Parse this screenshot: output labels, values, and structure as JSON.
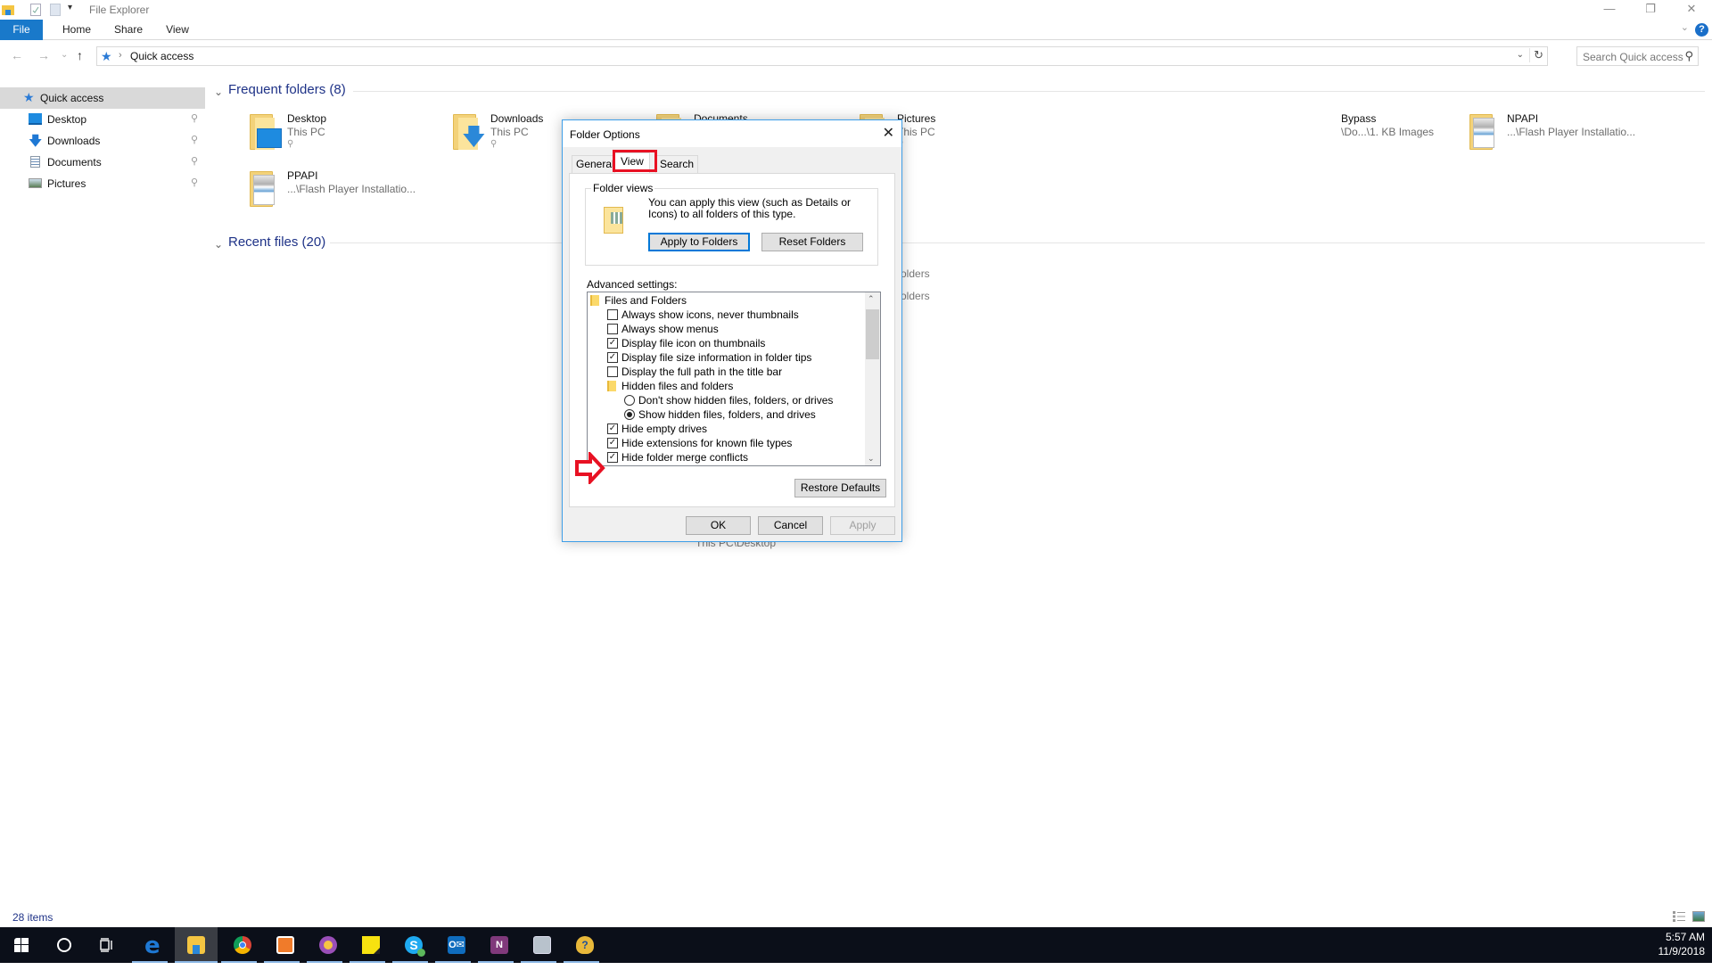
{
  "window": {
    "title": "File Explorer",
    "controls": {
      "minimize": "—",
      "restore": "❐",
      "close": "✕"
    }
  },
  "ribbon": {
    "tabs": [
      {
        "label": "File",
        "active": true
      },
      {
        "label": "Home"
      },
      {
        "label": "Share"
      },
      {
        "label": "View"
      }
    ],
    "help": "?",
    "expand": "⌄"
  },
  "address": {
    "back": "←",
    "forward": "→",
    "recent": "⌄",
    "up": "↑",
    "root_icon": "★",
    "separator": "›",
    "path": "Quick access",
    "dropdown": "⌄",
    "refresh": "↻"
  },
  "search": {
    "placeholder": "Search Quick access",
    "icon": "⚲"
  },
  "nav": {
    "items": [
      {
        "label": "Quick access",
        "icon": "quick-access",
        "selected": true,
        "pinned": false
      },
      {
        "label": "Desktop",
        "icon": "desktop",
        "pinned": true
      },
      {
        "label": "Downloads",
        "icon": "downloads",
        "pinned": true
      },
      {
        "label": "Documents",
        "icon": "documents",
        "pinned": true
      },
      {
        "label": "Pictures",
        "icon": "pictures",
        "pinned": true
      }
    ],
    "pin_glyph": "📌"
  },
  "main": {
    "frequent_header": "Frequent folders (8)",
    "recent_header": "Recent files (20)",
    "chevron": "⌄",
    "frequent": [
      {
        "name": "Desktop",
        "sub": "This PC",
        "pinned": true
      },
      {
        "name": "Downloads",
        "sub": "This PC",
        "pinned": true
      },
      {
        "name": "Documents",
        "sub": "",
        "pinned": false
      },
      {
        "name": "Pictures",
        "sub": "This PC",
        "pinned": true
      },
      {
        "name": "Bypass",
        "sub": "\\Do...\\1. KB Images",
        "pinned": false
      },
      {
        "name": "NPAPI",
        "sub": "...\\Flash Player Installatio...",
        "pinned": false
      },
      {
        "name": "PPAPI",
        "sub": "...\\Flash Player Installatio...",
        "pinned": false
      }
    ],
    "recent_partial": [
      "olders",
      "olders",
      "This PC\\Desktop"
    ]
  },
  "status": {
    "items": "28 items"
  },
  "dialog": {
    "title": "Folder Options",
    "close": "✕",
    "tabs": [
      {
        "label": "General"
      },
      {
        "label": "View",
        "selected": true,
        "highlighted": true
      },
      {
        "label": "Search"
      }
    ],
    "folder_views": {
      "legend": "Folder views",
      "description": "You can apply this view (such as Details or Icons) to all folders of this type.",
      "apply_btn": "Apply to Folders",
      "reset_btn": "Reset Folders"
    },
    "advanced_label": "Advanced settings:",
    "advanced": [
      {
        "type": "folder",
        "label": "Files and Folders",
        "indent": 0
      },
      {
        "type": "checkbox",
        "label": "Always show icons, never thumbnails",
        "checked": false,
        "indent": 1
      },
      {
        "type": "checkbox",
        "label": "Always show menus",
        "checked": false,
        "indent": 1
      },
      {
        "type": "checkbox",
        "label": "Display file icon on thumbnails",
        "checked": true,
        "indent": 1
      },
      {
        "type": "checkbox",
        "label": "Display file size information in folder tips",
        "checked": true,
        "indent": 1
      },
      {
        "type": "checkbox",
        "label": "Display the full path in the title bar",
        "checked": false,
        "indent": 1
      },
      {
        "type": "folder",
        "label": "Hidden files and folders",
        "indent": 1
      },
      {
        "type": "radio",
        "label": "Don't show hidden files, folders, or drives",
        "checked": false,
        "indent": 2
      },
      {
        "type": "radio",
        "label": "Show hidden files, folders, and drives",
        "checked": true,
        "indent": 2,
        "annotated": true
      },
      {
        "type": "checkbox",
        "label": "Hide empty drives",
        "checked": true,
        "indent": 1
      },
      {
        "type": "checkbox",
        "label": "Hide extensions for known file types",
        "checked": true,
        "indent": 1
      },
      {
        "type": "checkbox",
        "label": "Hide folder merge conflicts",
        "checked": true,
        "indent": 1
      }
    ],
    "scroll_up": "⌃",
    "scroll_down": "⌄",
    "check_glyph": "✓",
    "restore_btn": "Restore Defaults",
    "ok_btn": "OK",
    "cancel_btn": "Cancel",
    "apply_btn": "Apply",
    "annotation_color": "#e81123"
  },
  "taskbar": {
    "items": [
      {
        "name": "start",
        "color": "#ffffff"
      },
      {
        "name": "cortana",
        "color": "#ffffff"
      },
      {
        "name": "task-view",
        "color": "#ffffff"
      },
      {
        "name": "edge",
        "color": "#1e78d4"
      },
      {
        "name": "file-explorer",
        "color": "#f4c542",
        "active": true
      },
      {
        "name": "chrome",
        "color": "#e0463a"
      },
      {
        "name": "app-orange",
        "color": "#f07b2a"
      },
      {
        "name": "app-chat",
        "color": "#9a4fb8"
      },
      {
        "name": "sticky-notes",
        "color": "#f7e210"
      },
      {
        "name": "skype",
        "color": "#1eaaf1"
      },
      {
        "name": "outlook",
        "color": "#0f6cbd"
      },
      {
        "name": "onenote",
        "color": "#80397b"
      },
      {
        "name": "resource-monitor",
        "color": "#b8c2cc"
      },
      {
        "name": "help-app",
        "color": "#e8b83a"
      }
    ],
    "time": "5:57 AM",
    "date": "11/9/2018"
  }
}
